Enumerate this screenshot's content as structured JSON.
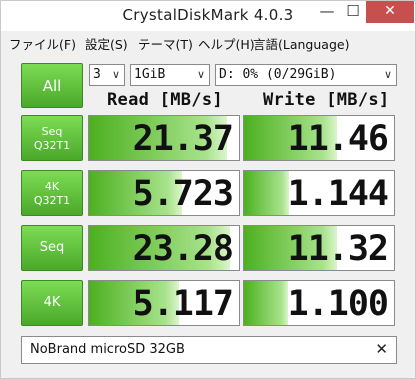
{
  "window": {
    "title": "CrystalDiskMark 4.0.3",
    "minimize_glyph": "—",
    "maximize_glyph": "☐",
    "close_glyph": "✕"
  },
  "menu": [
    {
      "label": "ファイル(F)"
    },
    {
      "label": "設定(S)"
    },
    {
      "label": "テーマ(T)"
    },
    {
      "label": "ヘルプ(H)"
    },
    {
      "label": "言語(Language)"
    }
  ],
  "controls": {
    "all_label": "All",
    "count_value": "3",
    "size_value": "1GiB",
    "drive_value": "D: 0% (0/29GiB)",
    "caret": "∨"
  },
  "headers": {
    "read": "Read [MB/s]",
    "write": "Write [MB/s]"
  },
  "tests": [
    {
      "line1": "Seq",
      "line2": "Q32T1",
      "read": "21.37",
      "write": "11.46",
      "read_fill": 0.92,
      "write_fill": 0.62
    },
    {
      "line1": "4K",
      "line2": "Q32T1",
      "read": "5.723",
      "write": "1.144",
      "read_fill": 0.62,
      "write_fill": 0.3
    },
    {
      "line1": "Seq",
      "line2": "",
      "read": "23.28",
      "write": "11.32",
      "read_fill": 0.94,
      "write_fill": 0.62
    },
    {
      "line1": "4K",
      "line2": "",
      "read": "5.117",
      "write": "1.100",
      "read_fill": 0.6,
      "write_fill": 0.29
    }
  ],
  "comment": {
    "text": "NoBrand microSD 32GB",
    "clear_glyph": "✕"
  }
}
